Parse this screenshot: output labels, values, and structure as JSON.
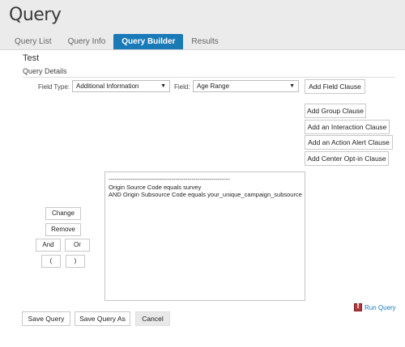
{
  "header": {
    "title": "Query",
    "tabs": [
      {
        "label": "Query List"
      },
      {
        "label": "Query Info"
      },
      {
        "label": "Query Builder"
      },
      {
        "label": "Results"
      }
    ]
  },
  "query": {
    "name": "Test",
    "section_title": "Query Details"
  },
  "fields": {
    "field_type_label": "Field Type:",
    "field_type_value": "Additional Information",
    "field_label": "Field:",
    "field_value": "Age Range"
  },
  "clause_buttons": {
    "add_field": "Add Field Clause",
    "add_group": "Add Group Clause",
    "add_interaction": "Add an Interaction Clause",
    "add_action_alert": "Add an Action Alert Clause",
    "add_center_opt_in": "Add Center Opt-in Clause"
  },
  "edit_buttons": {
    "change": "Change",
    "remove": "Remove",
    "and": "And",
    "or": "Or",
    "open_paren": "(",
    "close_paren": ")"
  },
  "query_text": {
    "separator": "------------------------------------------------------------",
    "line1": "Origin Source Code equals survey",
    "line2": "AND Origin Subsource Code equals your_unique_campaign_subsource"
  },
  "actions": {
    "save": "Save Query",
    "save_as": "Save Query As",
    "cancel": "Cancel",
    "run": "Run Query"
  },
  "colors": {
    "accent": "#1a7ab8",
    "header_bg": "#ebebeb",
    "warning": "#b23a3a"
  },
  "icons": {
    "dropdown": "chevron-down-icon",
    "run": "warning-icon"
  }
}
